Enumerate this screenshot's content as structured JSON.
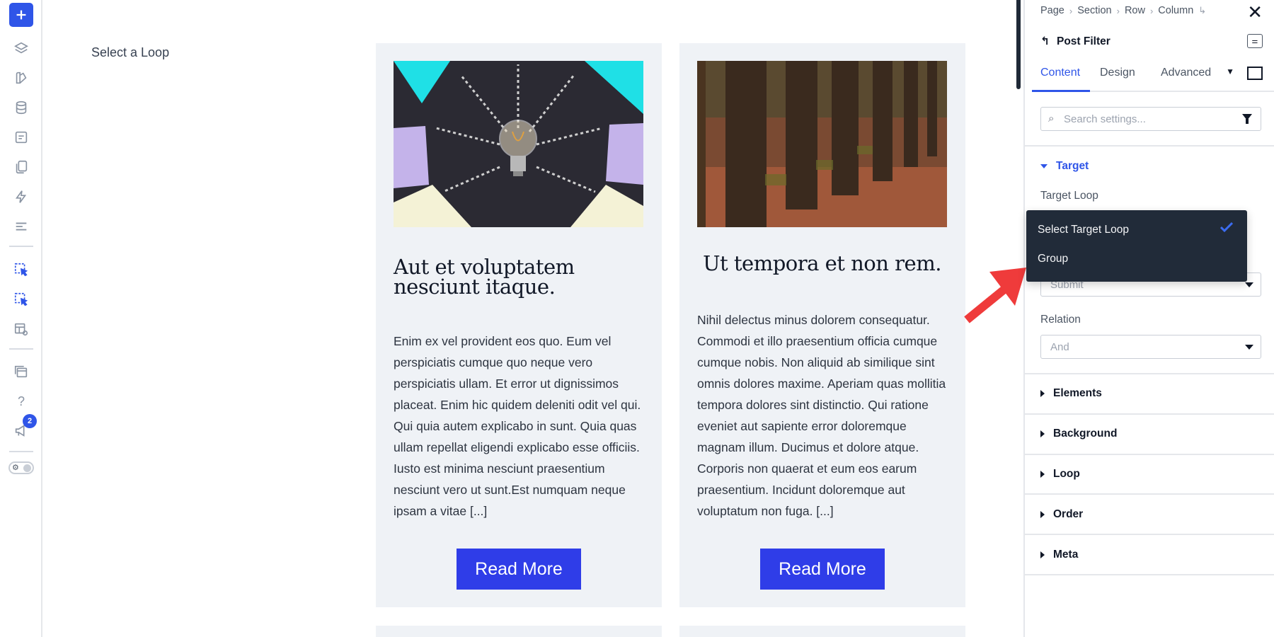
{
  "canvas": {
    "label": "Select a Loop",
    "cards": [
      {
        "title": "Aut et voluptatem nesciunt itaque.",
        "body": "Enim ex vel provident eos quo. Eum vel perspiciatis cumque quo neque vero perspiciatis ullam. Et error ut dignissimos placeat. Enim hic quidem deleniti odit vel qui. Qui quia autem explicabo in sunt. Quia quas ullam repellat eligendi explicabo esse officiis. Iusto est minima nesciunt praesentium nesciunt vero ut sunt.Est numquam neque ipsam a vitae [...]",
        "button": "Read More",
        "image": "lightbulb-on-chalkboard"
      },
      {
        "title": "Ut tempora et non rem.",
        "body": "Nihil delectus minus dolorem consequatur. Commodi et illo praesentium officia cumque cumque nobis. Non aliquid ab similique sint omnis dolores maxime. Aperiam quas mollitia tempora dolores sint distinctio. Qui ratione eveniet aut sapiente error doloremque magnam illum. Ducimus et dolore atque. Corporis non quaerat et eum eos earum praesentium. Incidunt doloremque aut voluptatum non fuga. [...]",
        "button": "Read More",
        "image": "wooden-fence-autumn"
      }
    ]
  },
  "toolbar": {
    "notifications_count": "2",
    "icons": [
      "plus-icon",
      "layers-icon",
      "brush-icon",
      "database-icon",
      "form-icon",
      "pages-icon",
      "lightning-icon",
      "list-icon",
      "loop-cursor-icon",
      "loop-cursor-icon",
      "template-eye-icon",
      "windows-icon",
      "help-icon",
      "megaphone-icon",
      "theme-toggle"
    ]
  },
  "panel": {
    "breadcrumb": [
      "Page",
      "Section",
      "Row",
      "Column"
    ],
    "title": "Post Filter",
    "tabs": [
      "Content",
      "Design",
      "Advanced"
    ],
    "search_placeholder": "Search settings...",
    "target_section": "Target",
    "target_loop_label": "Target Loop",
    "dropdown_options": [
      "Select Target Loop",
      "Group"
    ],
    "selected_option": "Select Target Loop",
    "submit_value": "Submit",
    "relation_label": "Relation",
    "relation_value": "And",
    "sections": [
      "Elements",
      "Background",
      "Loop",
      "Order",
      "Meta"
    ]
  },
  "colors": {
    "accent": "#2f55e8",
    "button": "#2f3de8",
    "card_bg": "#eff2f6",
    "dropdown_bg": "#212b39",
    "annotation_arrow": "#ef3b3b"
  }
}
